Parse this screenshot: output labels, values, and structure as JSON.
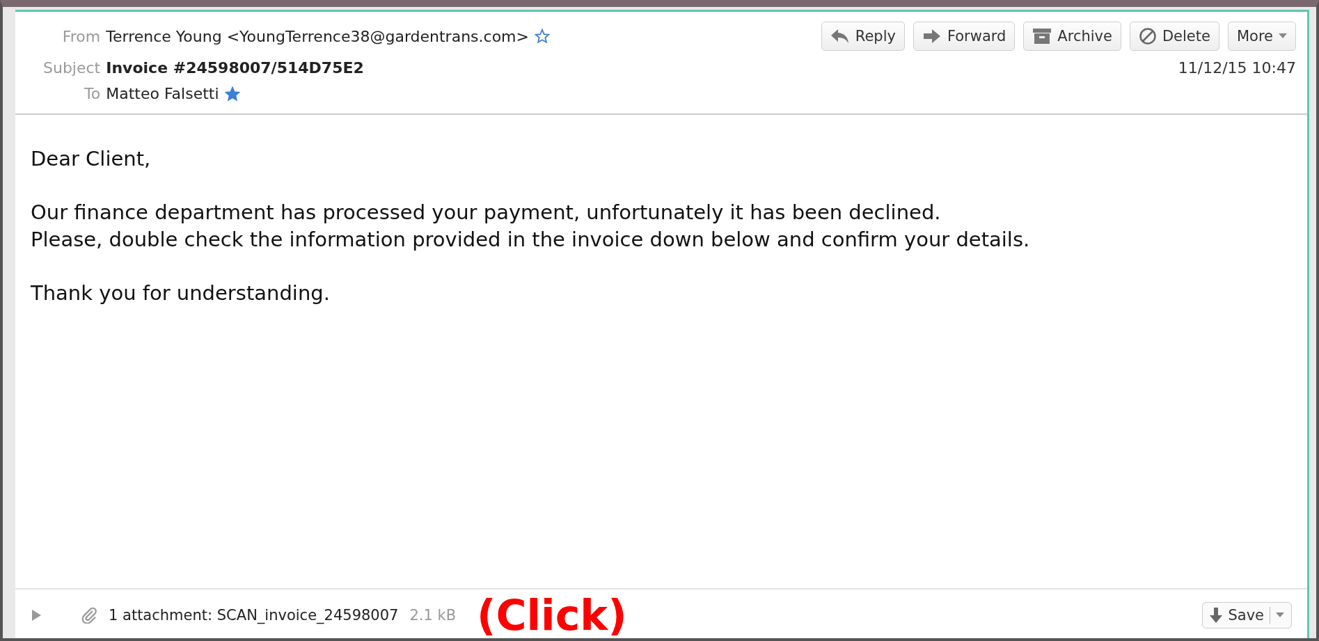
{
  "header": {
    "from_label": "From",
    "from": "Terrence Young <YoungTerrence38@gardentrans.com>",
    "from_starred": false,
    "subject_label": "Subject",
    "subject": "Invoice #24598007/514D75E2",
    "to_label": "To",
    "to": "Matteo Falsetti",
    "to_starred": true,
    "date": "11/12/15 10:47"
  },
  "actions": [
    {
      "label": "Reply",
      "kind": "reply"
    },
    {
      "label": "Forward",
      "kind": "forward"
    },
    {
      "label": "Archive",
      "kind": "archive"
    },
    {
      "label": "Delete",
      "kind": "delete"
    },
    {
      "label": "More",
      "kind": "menu"
    }
  ],
  "body": [
    "Dear Client,",
    "Our finance department has processed your payment, unfortunately it has been declined.\nPlease, double check the information provided in the invoice down below and confirm your details.",
    "Thank you for understanding."
  ],
  "attachments": {
    "expanded": false,
    "summary": "1 attachment: SCAN_invoice_24598007",
    "size": "2.1 kB",
    "save_label": "Save"
  },
  "annotation": "(Click)"
}
